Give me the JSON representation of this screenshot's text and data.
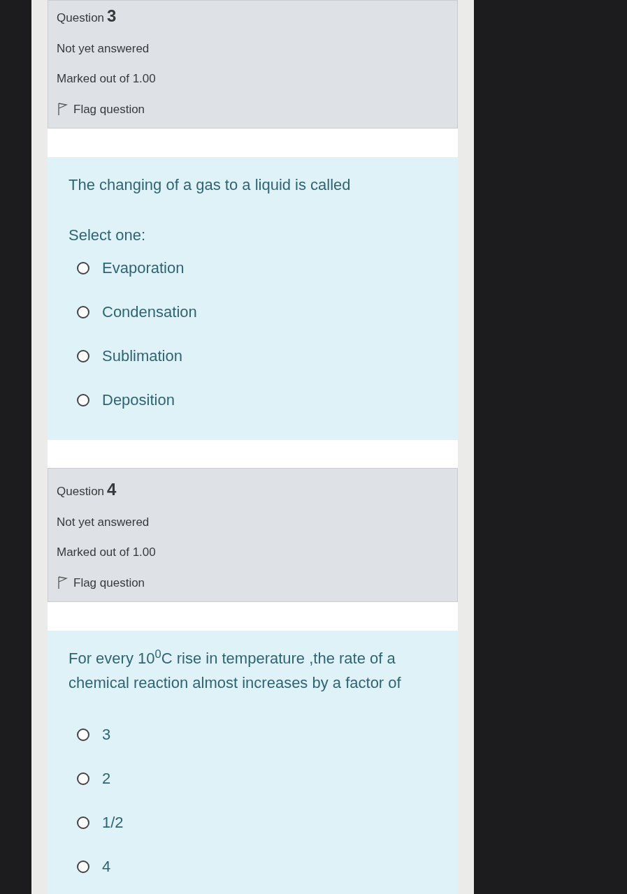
{
  "questions": [
    {
      "label": "Question",
      "number": "3",
      "status": "Not yet answered",
      "marks": "Marked out of 1.00",
      "flag": "Flag question",
      "text": "The changing of a gas to a liquid  is called",
      "prompt": "Select one:",
      "options": [
        {
          "label": "Evaporation",
          "selected": false
        },
        {
          "label": "Condensation",
          "selected": false
        },
        {
          "label": "Sublimation",
          "selected": false
        },
        {
          "label": "Deposition",
          "selected": false
        }
      ]
    },
    {
      "label": "Question",
      "number": "4",
      "status": "Not yet answered",
      "marks": "Marked out of 1.00",
      "flag": "Flag question",
      "text": "For every 10$^{0}$C rise in temperature ,the rate of a chemical reaction almost increases by a factor of",
      "options": [
        {
          "label": "3",
          "selected": false
        },
        {
          "label": "2",
          "selected": false
        },
        {
          "label": "1/2",
          "selected": false
        },
        {
          "label": "4",
          "selected": false
        }
      ]
    }
  ]
}
